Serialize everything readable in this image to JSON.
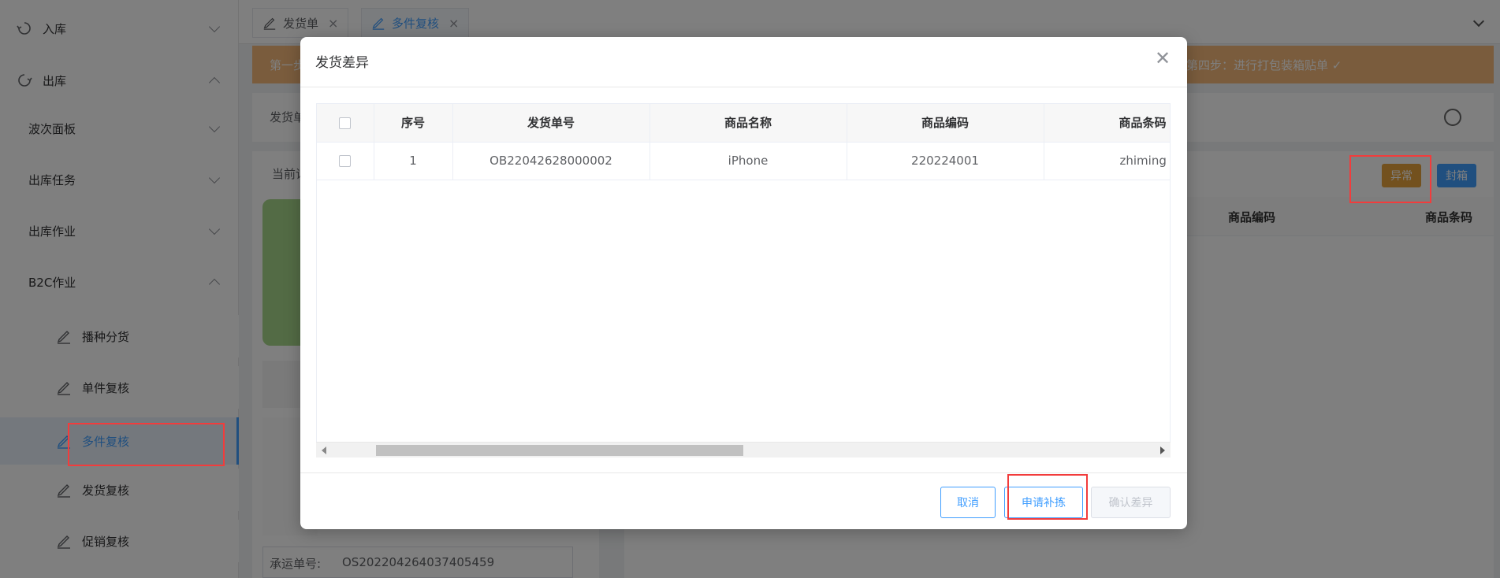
{
  "sidebar": {
    "items": [
      {
        "label": "入库",
        "icon": "inbound-icon",
        "expanded": false
      },
      {
        "label": "出库",
        "icon": "outbound-icon",
        "expanded": true
      },
      {
        "label": "波次面板",
        "expanded": false
      },
      {
        "label": "出库任务",
        "expanded": false
      },
      {
        "label": "出库作业",
        "expanded": false
      },
      {
        "label": "B2C作业",
        "expanded": true
      }
    ],
    "sub_items": [
      {
        "label": "播种分货",
        "active": false
      },
      {
        "label": "单件复核",
        "active": false
      },
      {
        "label": "多件复核",
        "active": true
      },
      {
        "label": "发货复核",
        "active": false
      },
      {
        "label": "促销复核",
        "active": false
      }
    ]
  },
  "tabs": [
    {
      "label": "发货单",
      "active": false
    },
    {
      "label": "多件复核",
      "active": true
    }
  ],
  "banner": {
    "left_text": "第一步",
    "right_text": "第四步：进行打包装箱贴单 ✓"
  },
  "background": {
    "filter_label": "发货单",
    "current_label": "当前详",
    "carrier_label": "承运单号:",
    "carrier_value": "OS202204264037405459",
    "right_table_headers": [
      "商品编码",
      "商品条码"
    ],
    "abnormal_button": "异常",
    "seal_button": "封箱"
  },
  "dialog": {
    "title": "发货差异",
    "table": {
      "headers": [
        "序号",
        "发货单号",
        "商品名称",
        "商品编码",
        "商品条码"
      ],
      "rows": [
        {
          "index": "1",
          "order_no": "OB22042628000002",
          "name": "iPhone",
          "code": "220224001",
          "barcode": "zhiming"
        }
      ]
    },
    "buttons": {
      "cancel": "取消",
      "request_repick": "申请补拣",
      "confirm_diff": "确认差异"
    }
  },
  "colors": {
    "accent": "#409eff",
    "warning": "#e6a23c",
    "banner": "#f5b97a",
    "highlight_box": "#f23c3c"
  }
}
